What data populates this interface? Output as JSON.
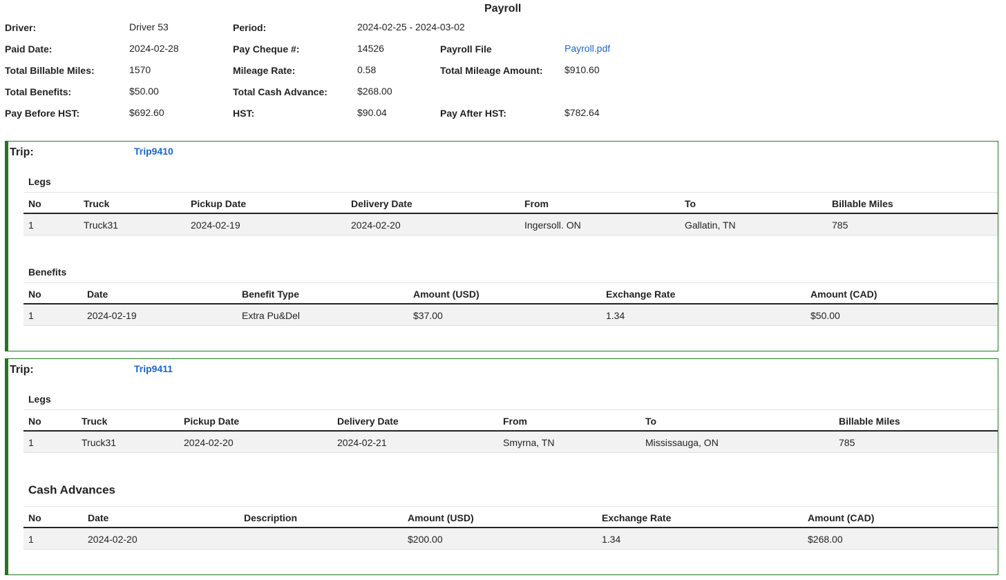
{
  "page_title": "Payroll",
  "summary": {
    "driver_label": "Driver:",
    "driver": "Driver 53",
    "period_label": "Period:",
    "period": "2024-02-25 - 2024-03-02",
    "paid_date_label": "Paid Date:",
    "paid_date": "2024-02-28",
    "pay_cheque_label": "Pay Cheque #:",
    "pay_cheque": "14526",
    "payroll_file_label": "Payroll File",
    "payroll_file": "Payroll.pdf",
    "billable_miles_label": "Total Billable Miles:",
    "billable_miles": "1570",
    "mileage_rate_label": "Mileage Rate:",
    "mileage_rate": "0.58",
    "mileage_amount_label": "Total Mileage Amount:",
    "mileage_amount": "$910.60",
    "benefits_label": "Total Benefits:",
    "benefits": "$50.00",
    "cash_advance_label": "Total Cash Advance:",
    "cash_advance": "$268.00",
    "pay_before_label": "Pay Before HST:",
    "pay_before": "$692.60",
    "hst_label": "HST:",
    "hst": "$90.04",
    "pay_after_label": "Pay After HST:",
    "pay_after": "$782.64"
  },
  "trips": [
    {
      "label": "Trip:",
      "trip_id": "Trip9410",
      "legs_title": "Legs",
      "legs_headers": [
        "No",
        "Truck",
        "Pickup Date",
        "Delivery Date",
        "From",
        "To",
        "Billable Miles"
      ],
      "legs_rows": [
        [
          "1",
          "Truck31",
          "2024-02-19",
          "2024-02-20",
          "Ingersoll. ON",
          "Gallatin, TN",
          "785"
        ]
      ],
      "extra_title": "Benefits",
      "extra_headers": [
        "No",
        "Date",
        "Benefit Type",
        "Amount (USD)",
        "Exchange Rate",
        "Amount (CAD)"
      ],
      "extra_rows": [
        [
          "1",
          "2024-02-19",
          "Extra Pu&Del",
          "$37.00",
          "1.34",
          "$50.00"
        ]
      ]
    },
    {
      "label": "Trip:",
      "trip_id": "Trip9411",
      "legs_title": "Legs",
      "legs_headers": [
        "No",
        "Truck",
        "Pickup Date",
        "Delivery Date",
        "From",
        "To",
        "Billable Miles"
      ],
      "legs_rows": [
        [
          "1",
          "Truck31",
          "2024-02-20",
          "2024-02-21",
          "Smyrna, TN",
          "Mississauga, ON",
          "785"
        ]
      ],
      "extra_title": "Cash Advances",
      "extra_headers": [
        "No",
        "Date",
        "Description",
        "Amount (USD)",
        "Exchange Rate",
        "Amount (CAD)"
      ],
      "extra_rows": [
        [
          "1",
          "2024-02-20",
          "",
          "$200.00",
          "1.34",
          "$268.00"
        ]
      ]
    }
  ]
}
